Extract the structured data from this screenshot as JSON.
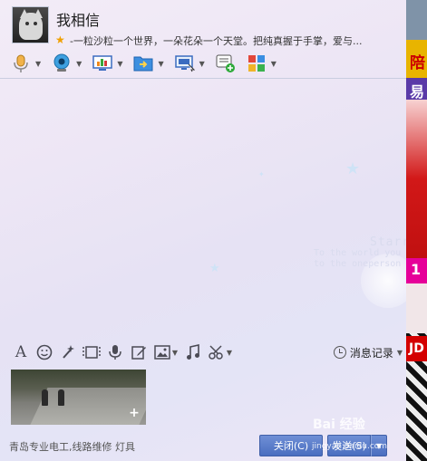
{
  "contact": {
    "name": "我相信",
    "signature": "-一粒沙粒一个世界，一朵花朵一个天堂。把纯真握于手掌，爱与..."
  },
  "toolbar": {
    "items": [
      {
        "icon": "microphone-icon"
      },
      {
        "icon": "webcam-icon"
      },
      {
        "icon": "screen-share-icon"
      },
      {
        "icon": "file-transfer-icon"
      },
      {
        "icon": "remote-assist-icon"
      },
      {
        "icon": "message-add-icon"
      },
      {
        "icon": "apps-grid-icon"
      }
    ]
  },
  "input_toolbar": {
    "font_label": "A",
    "history_label": "消息记录"
  },
  "background": {
    "deco_line1": "Starr",
    "deco_line2": "To the world you",
    "deco_line3": "to the oneperson"
  },
  "footer": {
    "ad_text": "青岛专业电工,线路维修 灯具",
    "close_label": "关闭(C)",
    "send_label": "发送(S)",
    "watermark": "Bai 经验",
    "watermark_sub": "jingyan.baidu.com"
  },
  "side_ad": {
    "text_a": "陪",
    "text_b": "易",
    "text_c": "1",
    "text_d": "JD"
  },
  "colors": {
    "button_blue": "#4a6ec0",
    "star_yellow": "#f0a000"
  }
}
